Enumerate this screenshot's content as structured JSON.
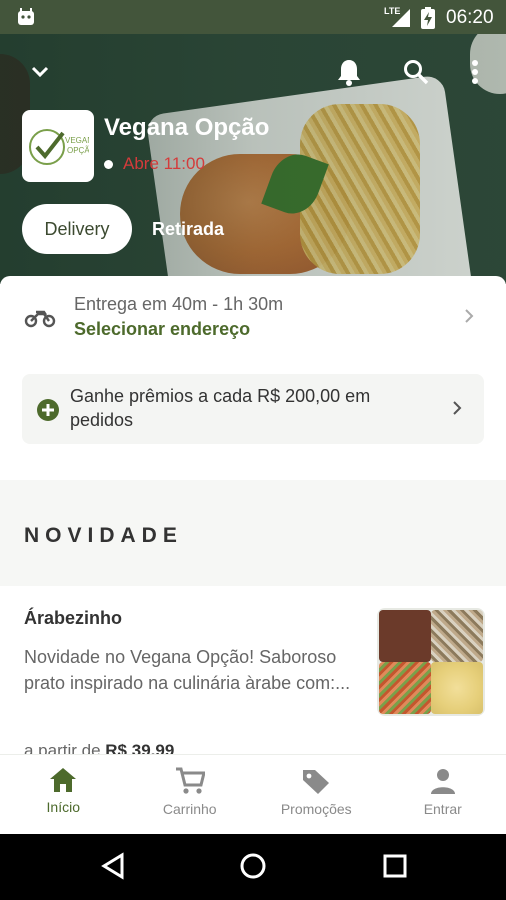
{
  "status_bar": {
    "time": "06:20",
    "network": "LTE"
  },
  "store": {
    "name": "Vegana Opção",
    "open_label": "Abre 11:00",
    "logo_text_top": "VEGANA",
    "logo_text_bottom": "OPÇÃO"
  },
  "modes": {
    "delivery": "Delivery",
    "pickup": "Retirada"
  },
  "delivery": {
    "eta": "Entrega em 40m - 1h 30m",
    "address_action": "Selecionar endereço"
  },
  "rewards": {
    "text": "Ganhe prêmios a cada R$ 200,00 em pedidos"
  },
  "section": {
    "title": "NOVIDADE"
  },
  "product": {
    "name": "Árabezinho",
    "description": "Novidade no Vegana Opção! Saboroso prato inspirado na culinária àrabe com:...",
    "price_prefix": "a partir de",
    "price": "R$ 39,99"
  },
  "bottom_nav": [
    {
      "label": "Início",
      "icon": "home-icon",
      "active": true
    },
    {
      "label": "Carrinho",
      "icon": "cart-icon",
      "active": false
    },
    {
      "label": "Promoções",
      "icon": "tag-icon",
      "active": false
    },
    {
      "label": "Entrar",
      "icon": "person-icon",
      "active": false
    }
  ],
  "colors": {
    "brand_green": "#4d6a2c",
    "closed_red": "#d43b3b",
    "status_bar": "#43553b"
  }
}
